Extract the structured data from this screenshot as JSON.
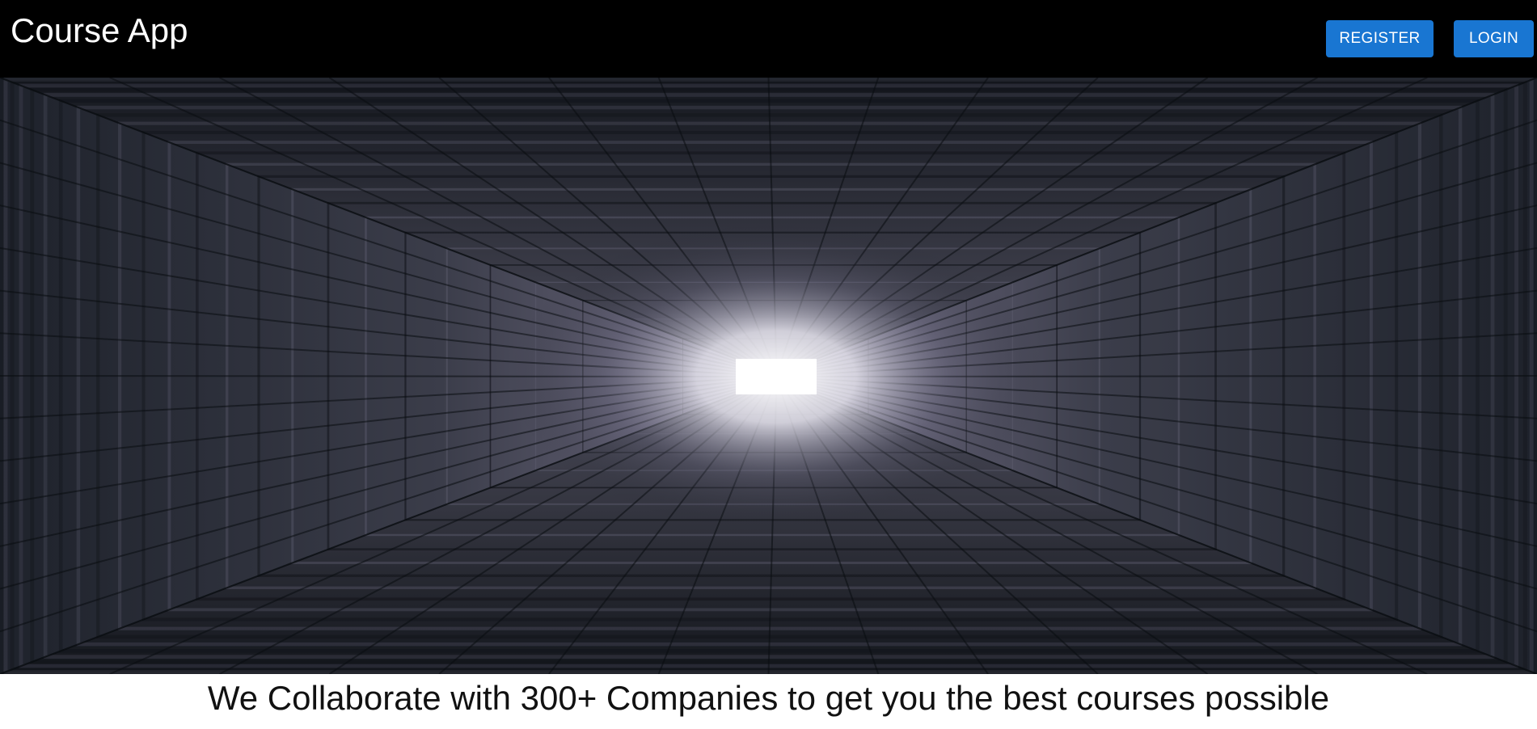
{
  "header": {
    "app_title": "Course App",
    "register_label": "REGISTER",
    "login_label": "LOGIN"
  },
  "hero": {
    "image_subject": "dark-tunnel-corridor",
    "light_color": "#ffffff",
    "wall_color": "#2a2f3a"
  },
  "main": {
    "tagline": "We Collaborate with 300+ Companies to get you the best courses possible"
  },
  "colors": {
    "header_bg": "#000000",
    "button_bg": "#1976d2",
    "button_text": "#ffffff"
  }
}
